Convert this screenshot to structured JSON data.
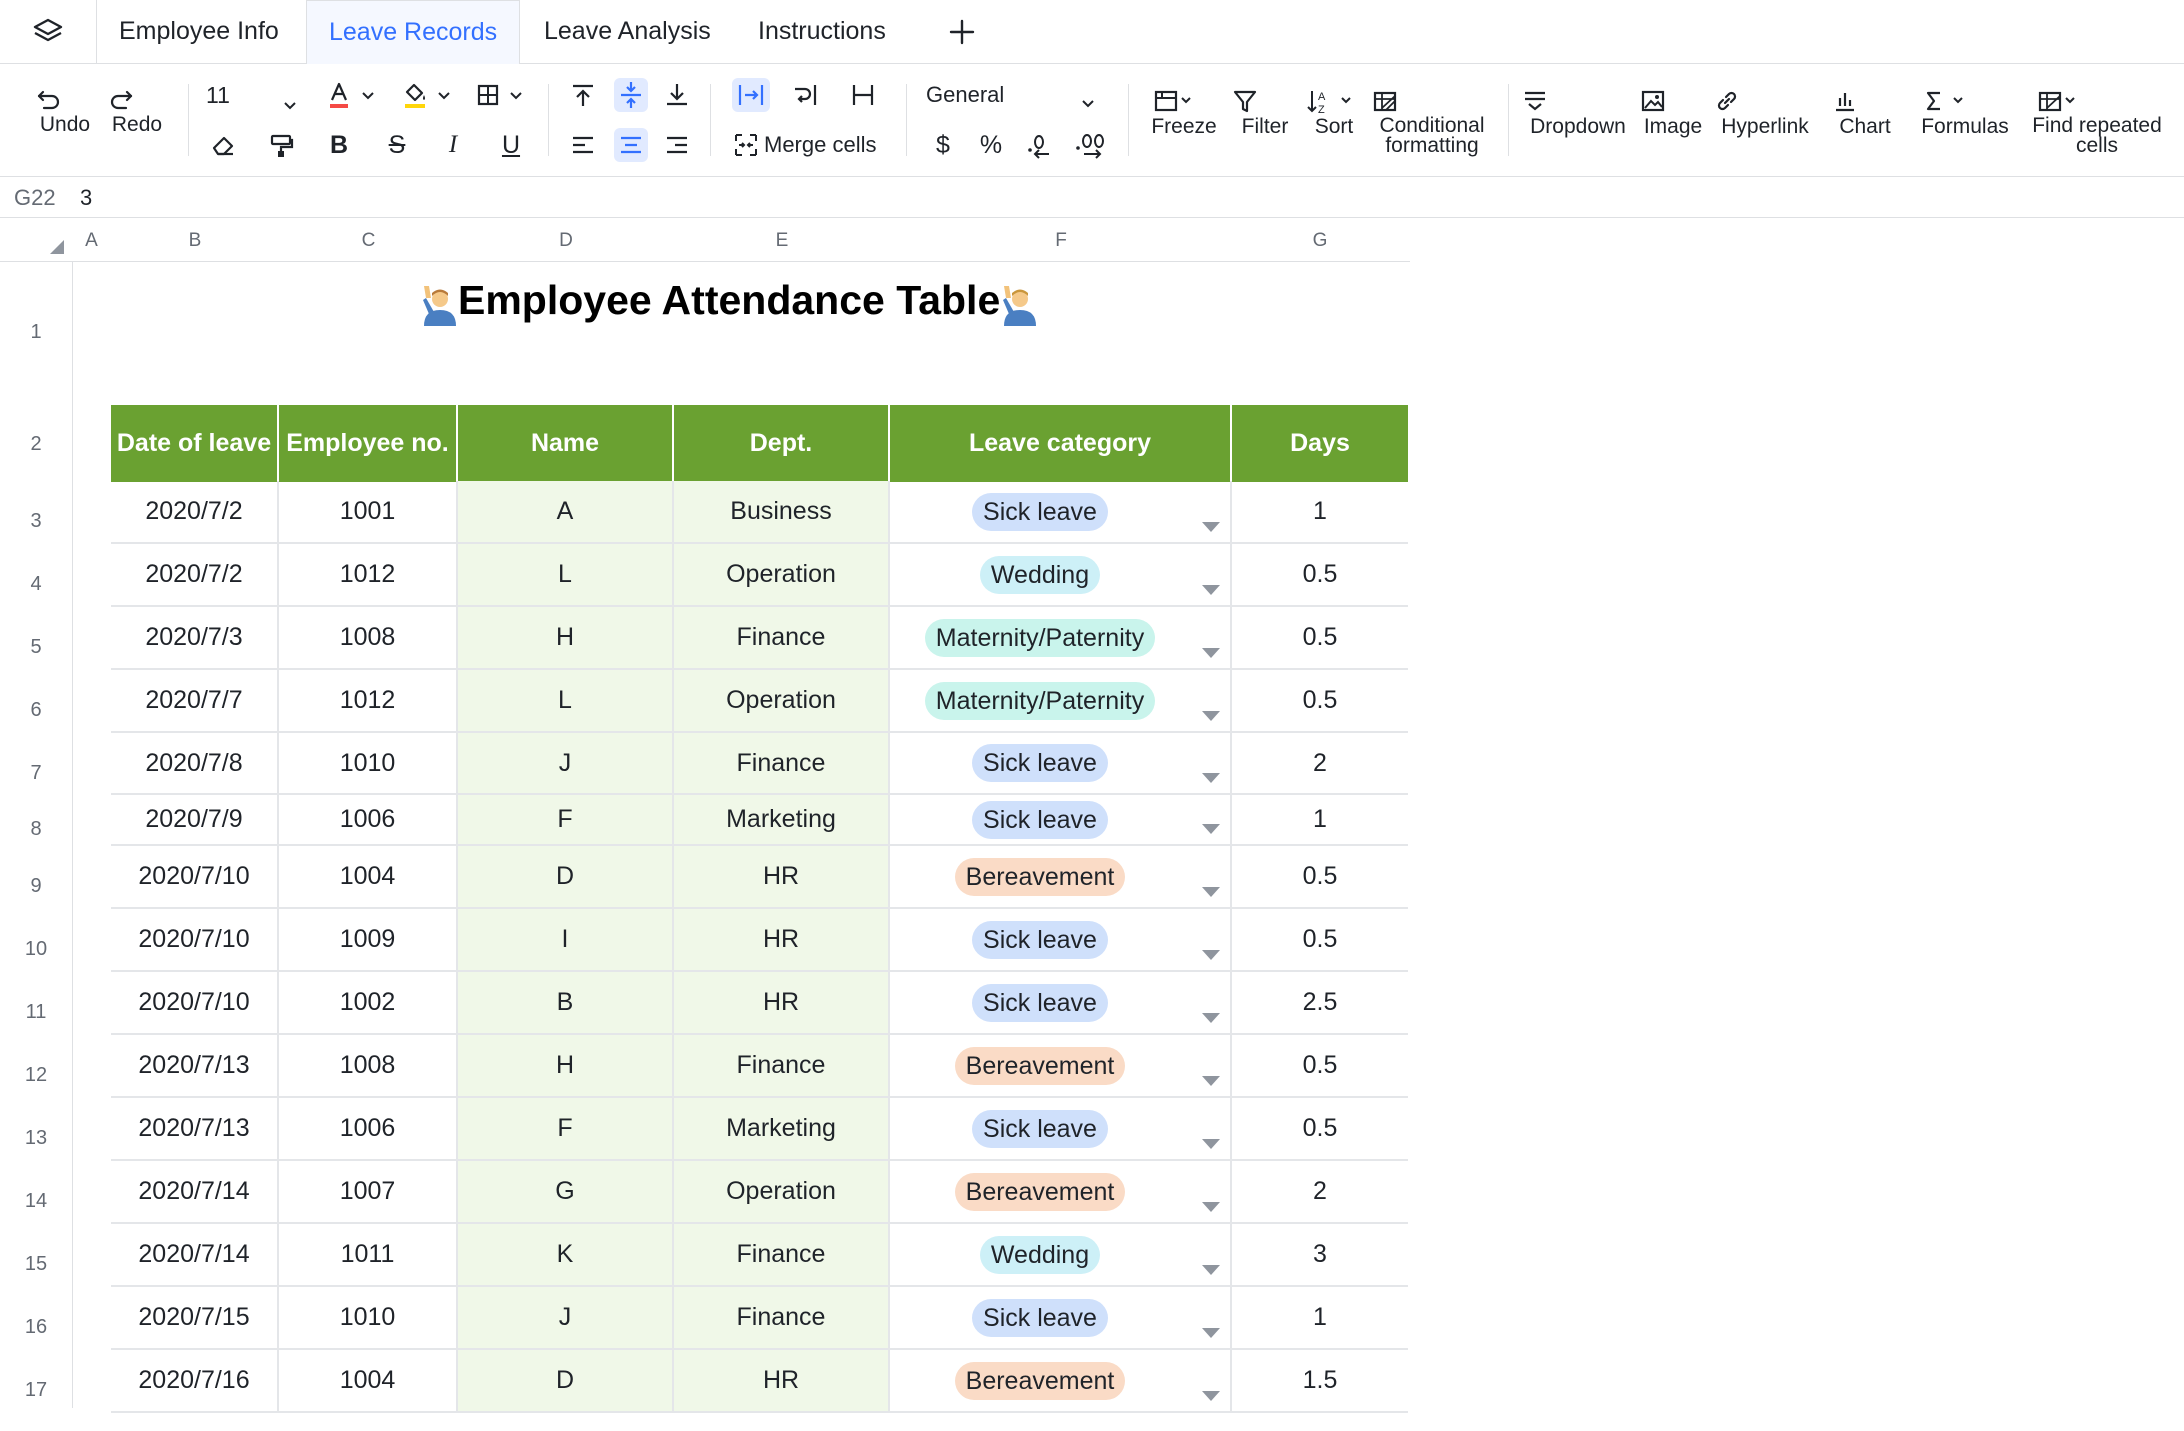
{
  "tabs": [
    {
      "label": "Employee Info",
      "active": false
    },
    {
      "label": "Leave Records",
      "active": true
    },
    {
      "label": "Leave Analysis",
      "active": false
    },
    {
      "label": "Instructions",
      "active": false
    }
  ],
  "toolbar": {
    "undo": "Undo",
    "redo": "Redo",
    "font_size": "11",
    "merge_cells": "Merge cells",
    "number_format": "General",
    "currency": "$",
    "percent": "%",
    "freeze": "Freeze",
    "filter": "Filter",
    "sort": "Sort",
    "conditional_1": "Conditional",
    "conditional_2": "formatting",
    "dropdown": "Dropdown",
    "image": "Image",
    "hyperlink": "Hyperlink",
    "chart": "Chart",
    "formulas": "Formulas",
    "find_repeated_1": "Find repeated",
    "find_repeated_2": "cells",
    "colors": {
      "font_color": "#f54a45",
      "fill_color": "#ffd60a",
      "active_icon": "#3370ff"
    }
  },
  "formula_bar": {
    "cell_ref": "G22",
    "value": "3"
  },
  "columns": [
    "A",
    "B",
    "C",
    "D",
    "E",
    "F",
    "G"
  ],
  "rows": [
    "1",
    "2",
    "3",
    "4",
    "5",
    "6",
    "7",
    "8",
    "9",
    "10",
    "11",
    "12",
    "13",
    "14",
    "15",
    "16",
    "17"
  ],
  "sheet": {
    "title": "Employee Attendance Table",
    "title_icon": "person-raising-hand-emoji",
    "header_color": "#6aa131",
    "headers": [
      "Date of leave",
      "Employee no.",
      "Name",
      "Dept.",
      "Leave category",
      "Days"
    ],
    "category_colors": {
      "Sick leave": "#cfe0fb",
      "Wedding": "#cdf0f7",
      "Maternity/Paternity": "#c9f4ec",
      "Bereavement": "#fadbc6"
    },
    "records": [
      {
        "date": "2020/7/2",
        "emp_no": "1001",
        "name": "A",
        "dept": "Business",
        "category": "Sick leave",
        "days": "1"
      },
      {
        "date": "2020/7/2",
        "emp_no": "1012",
        "name": "L",
        "dept": "Operation",
        "category": "Wedding",
        "days": "0.5"
      },
      {
        "date": "2020/7/3",
        "emp_no": "1008",
        "name": "H",
        "dept": "Finance",
        "category": "Maternity/Paternity",
        "days": "0.5"
      },
      {
        "date": "2020/7/7",
        "emp_no": "1012",
        "name": "L",
        "dept": "Operation",
        "category": "Maternity/Paternity",
        "days": "0.5"
      },
      {
        "date": "2020/7/8",
        "emp_no": "1010",
        "name": "J",
        "dept": "Finance",
        "category": "Sick leave",
        "days": "2"
      },
      {
        "date": "2020/7/9",
        "emp_no": "1006",
        "name": "F",
        "dept": "Marketing",
        "category": "Sick leave",
        "days": "1"
      },
      {
        "date": "2020/7/10",
        "emp_no": "1004",
        "name": "D",
        "dept": "HR",
        "category": "Bereavement",
        "days": "0.5"
      },
      {
        "date": "2020/7/10",
        "emp_no": "1009",
        "name": "I",
        "dept": "HR",
        "category": "Sick leave",
        "days": "0.5"
      },
      {
        "date": "2020/7/10",
        "emp_no": "1002",
        "name": "B",
        "dept": "HR",
        "category": "Sick leave",
        "days": "2.5"
      },
      {
        "date": "2020/7/13",
        "emp_no": "1008",
        "name": "H",
        "dept": "Finance",
        "category": "Bereavement",
        "days": "0.5"
      },
      {
        "date": "2020/7/13",
        "emp_no": "1006",
        "name": "F",
        "dept": "Marketing",
        "category": "Sick leave",
        "days": "0.5"
      },
      {
        "date": "2020/7/14",
        "emp_no": "1007",
        "name": "G",
        "dept": "Operation",
        "category": "Bereavement",
        "days": "2"
      },
      {
        "date": "2020/7/14",
        "emp_no": "1011",
        "name": "K",
        "dept": "Finance",
        "category": "Wedding",
        "days": "3"
      },
      {
        "date": "2020/7/15",
        "emp_no": "1010",
        "name": "J",
        "dept": "Finance",
        "category": "Sick leave",
        "days": "1"
      },
      {
        "date": "2020/7/16",
        "emp_no": "1004",
        "name": "D",
        "dept": "HR",
        "category": "Bereavement",
        "days": "1.5"
      }
    ]
  }
}
